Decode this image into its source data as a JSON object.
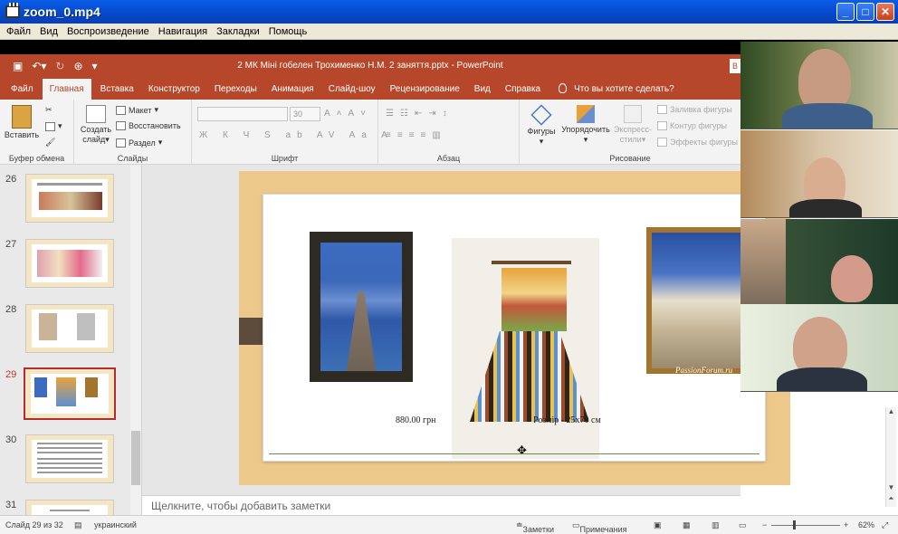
{
  "window": {
    "title": "zoom_0.mp4"
  },
  "menu": [
    "Файл",
    "Вид",
    "Воспроизведение",
    "Навигация",
    "Закладки",
    "Помощь"
  ],
  "powerpoint": {
    "doc_title": "2 МК Міні гобелен Трохименко Н.М. 2 заняття.pptx  -  PowerPoint",
    "tabs": [
      "Файл",
      "Главная",
      "Вставка",
      "Конструктор",
      "Переходы",
      "Анимация",
      "Слайд-шоу",
      "Рецензирование",
      "Вид",
      "Справка"
    ],
    "active_tab": "Главная",
    "tell_me": "Что вы хотите сделать?",
    "ribbon": {
      "clipboard": {
        "paste": "Вставить",
        "label": "Буфер обмена"
      },
      "slides": {
        "new_slide_line1": "Создать",
        "new_slide_line2": "слайд",
        "layout": "Макет",
        "reset": "Восстановить",
        "section": "Раздел",
        "label": "Слайды"
      },
      "font": {
        "size": "30",
        "label": "Шрифт",
        "glyphs": "Ж К Ч S ab AV Aa A"
      },
      "paragraph": {
        "label": "Абзац"
      },
      "drawing": {
        "shapes": "Фигуры",
        "arrange": "Упорядочить",
        "quick_styles_line1": "Экспресс-",
        "quick_styles_line2": "стили",
        "fill": "Заливка фигуры",
        "outline": "Контур фигуры",
        "effects": "Эффекты фигуры",
        "label": "Рисование"
      }
    },
    "thumbnails": [
      {
        "num": "26"
      },
      {
        "num": "27"
      },
      {
        "num": "28"
      },
      {
        "num": "29",
        "selected": true
      },
      {
        "num": "30"
      },
      {
        "num": "31"
      }
    ],
    "slide": {
      "watermark": "PassionForum.ru",
      "price": "880.00 грн",
      "size": "Розмір - 25х70 см"
    },
    "notes_placeholder": "Щелкните, чтобы добавить заметки",
    "status": {
      "slide_counter": "Слайд 29 из 32",
      "language": "украинский",
      "notes_btn": "Заметки",
      "comments_btn": "Примечания",
      "zoom": "62%"
    }
  }
}
